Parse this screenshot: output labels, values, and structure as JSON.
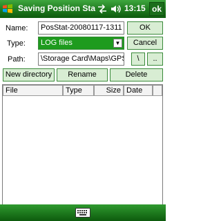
{
  "titlebar": {
    "title": "Saving Position Sta",
    "clock": "13:15",
    "ok_label": "ok",
    "icons": [
      "windows-start-icon",
      "connectivity-icon",
      "volume-icon"
    ]
  },
  "form": {
    "name_label": "Name:",
    "name_value": "PosStat-20080117-1311",
    "type_label": "Type:",
    "type_value": "LOG files",
    "path_label": "Path:",
    "path_value": "\\Storage Card\\Maps\\GPS",
    "ok_button": "OK",
    "cancel_button": "Cancel",
    "root_button": "\\",
    "up_button": ".."
  },
  "actions": {
    "new_directory": "New directory",
    "rename": "Rename",
    "delete": "Delete"
  },
  "list": {
    "columns": [
      "File",
      "Type",
      "Size",
      "Date"
    ],
    "rows": []
  },
  "colors": {
    "titlebar": "#1f7a1f",
    "accent": "#1e9b1e",
    "button_bg": "#d8edd3"
  }
}
